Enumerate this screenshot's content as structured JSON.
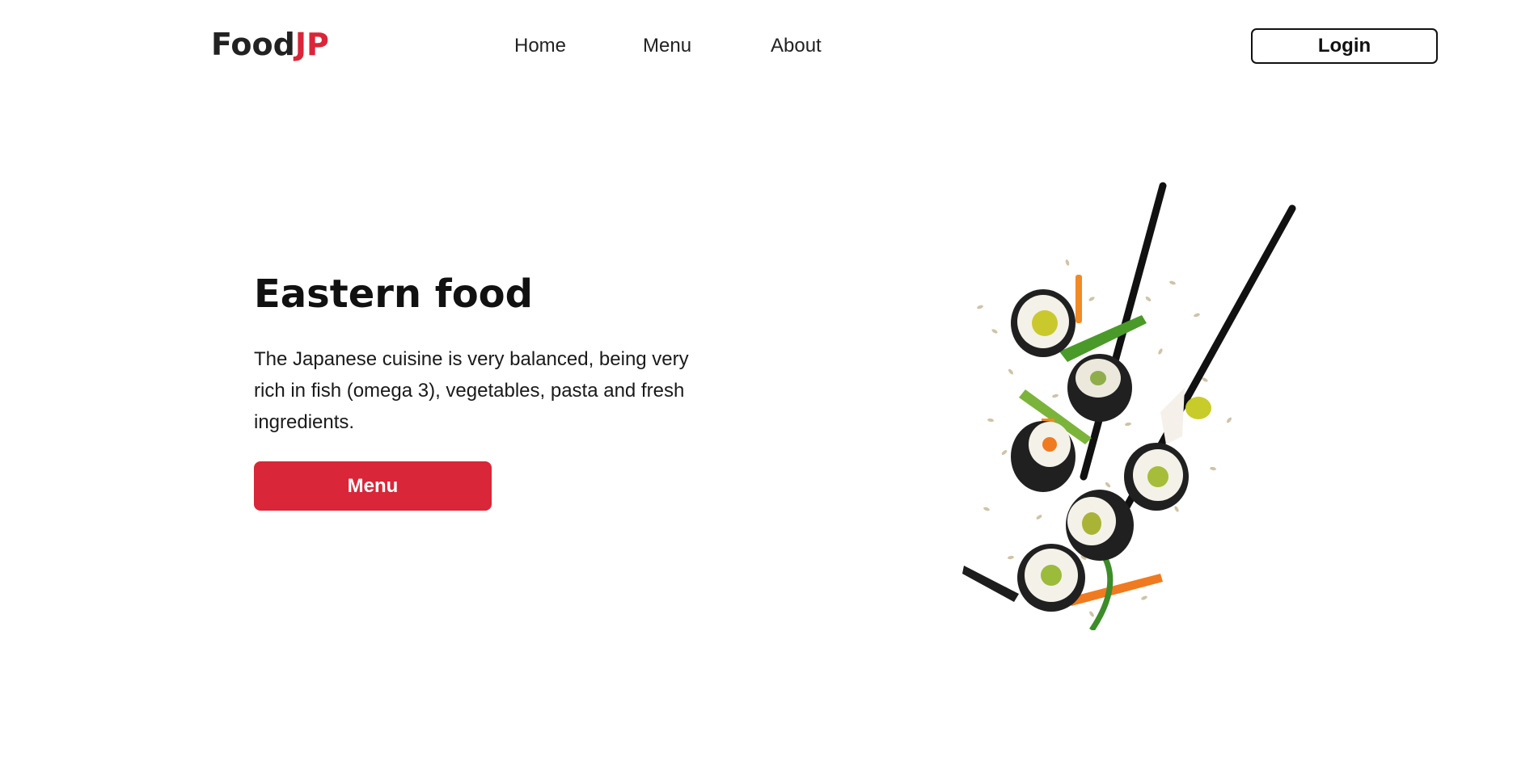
{
  "header": {
    "logo_main": "Food",
    "logo_accent": "JP",
    "nav": [
      {
        "label": "Home"
      },
      {
        "label": "Menu"
      },
      {
        "label": "About"
      }
    ],
    "login_label": "Login"
  },
  "hero": {
    "title": "Eastern food",
    "description": "The Japanese cuisine is very balanced, being very rich in fish (omega 3), vegetables, pasta and fresh ingredients.",
    "cta_label": "Menu"
  },
  "colors": {
    "accent": "#d92638",
    "text": "#111111",
    "background": "#ffffff"
  },
  "icons": {
    "hero_image": "sushi-chopsticks-illustration"
  }
}
